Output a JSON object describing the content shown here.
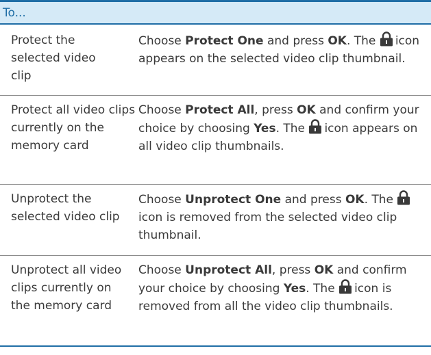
{
  "header": {
    "label": "To..."
  },
  "rows": [
    {
      "task": "Protect the selected video clip",
      "choose": "Choose",
      "option": "Protect One",
      "press": "and press",
      "ok": "OK",
      "the": ". The",
      "result": "icon appears on the selected video clip thumbnail."
    },
    {
      "task": "Protect all video clips currently on the memory card",
      "choose": "Choose",
      "option": "Protect All",
      "press": ", press",
      "ok": "OK",
      "confirm": "and confirm your choice by choosing",
      "yes": "Yes",
      "the": ". The",
      "result": "icon appears on all video clip thumbnails."
    },
    {
      "task": "Unprotect the selected video clip",
      "choose": "Choose",
      "option": "Unprotect One",
      "press": "and press",
      "ok": "OK",
      "the": ". The",
      "result": "icon is removed from the selected video clip thumbnail."
    },
    {
      "task": "Unprotect all video clips currently on the memory card",
      "choose": "Choose",
      "option": "Unprotect All",
      "press": ", press",
      "ok": "OK",
      "confirm": "and confirm your choice by choosing",
      "yes": "Yes",
      "the": ". The",
      "result": "icon is removed from all the video clip thumbnails."
    }
  ],
  "icons": {
    "lock": "lock-icon"
  },
  "colors": {
    "accent": "#1f6ea6",
    "header_bg": "#d5eaf7",
    "text": "#3a3a3a"
  }
}
